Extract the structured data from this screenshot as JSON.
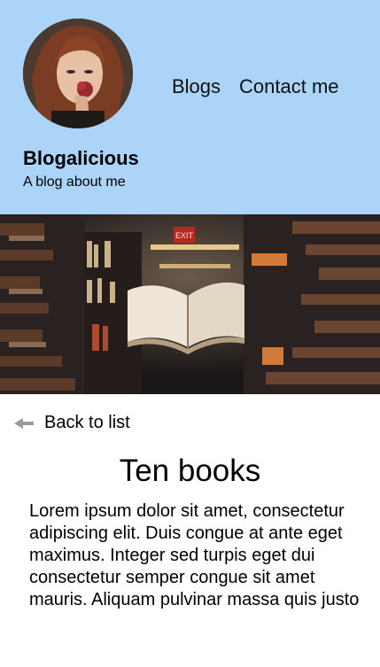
{
  "header": {
    "avatar_icon": "profile-photo",
    "nav": {
      "blogs_label": "Blogs",
      "contact_label": "Contact me"
    },
    "site_title": "Blogalicious",
    "tagline": "A blog about me"
  },
  "hero": {
    "image_description_icon": "library-book-photo",
    "exit_sign": "EXIT"
  },
  "post": {
    "back_label": "Back to list",
    "title": "Ten books",
    "body": "Lorem ipsum dolor sit amet, consectetur adipiscing elit. Duis congue at ante eget maximus. Integer sed turpis eget dui consectetur semper congue sit amet mauris. Aliquam pulvinar massa quis justo"
  },
  "colors": {
    "header_bg": "#acd3f8",
    "text": "#000000",
    "arrow": "#9a9a9a"
  }
}
